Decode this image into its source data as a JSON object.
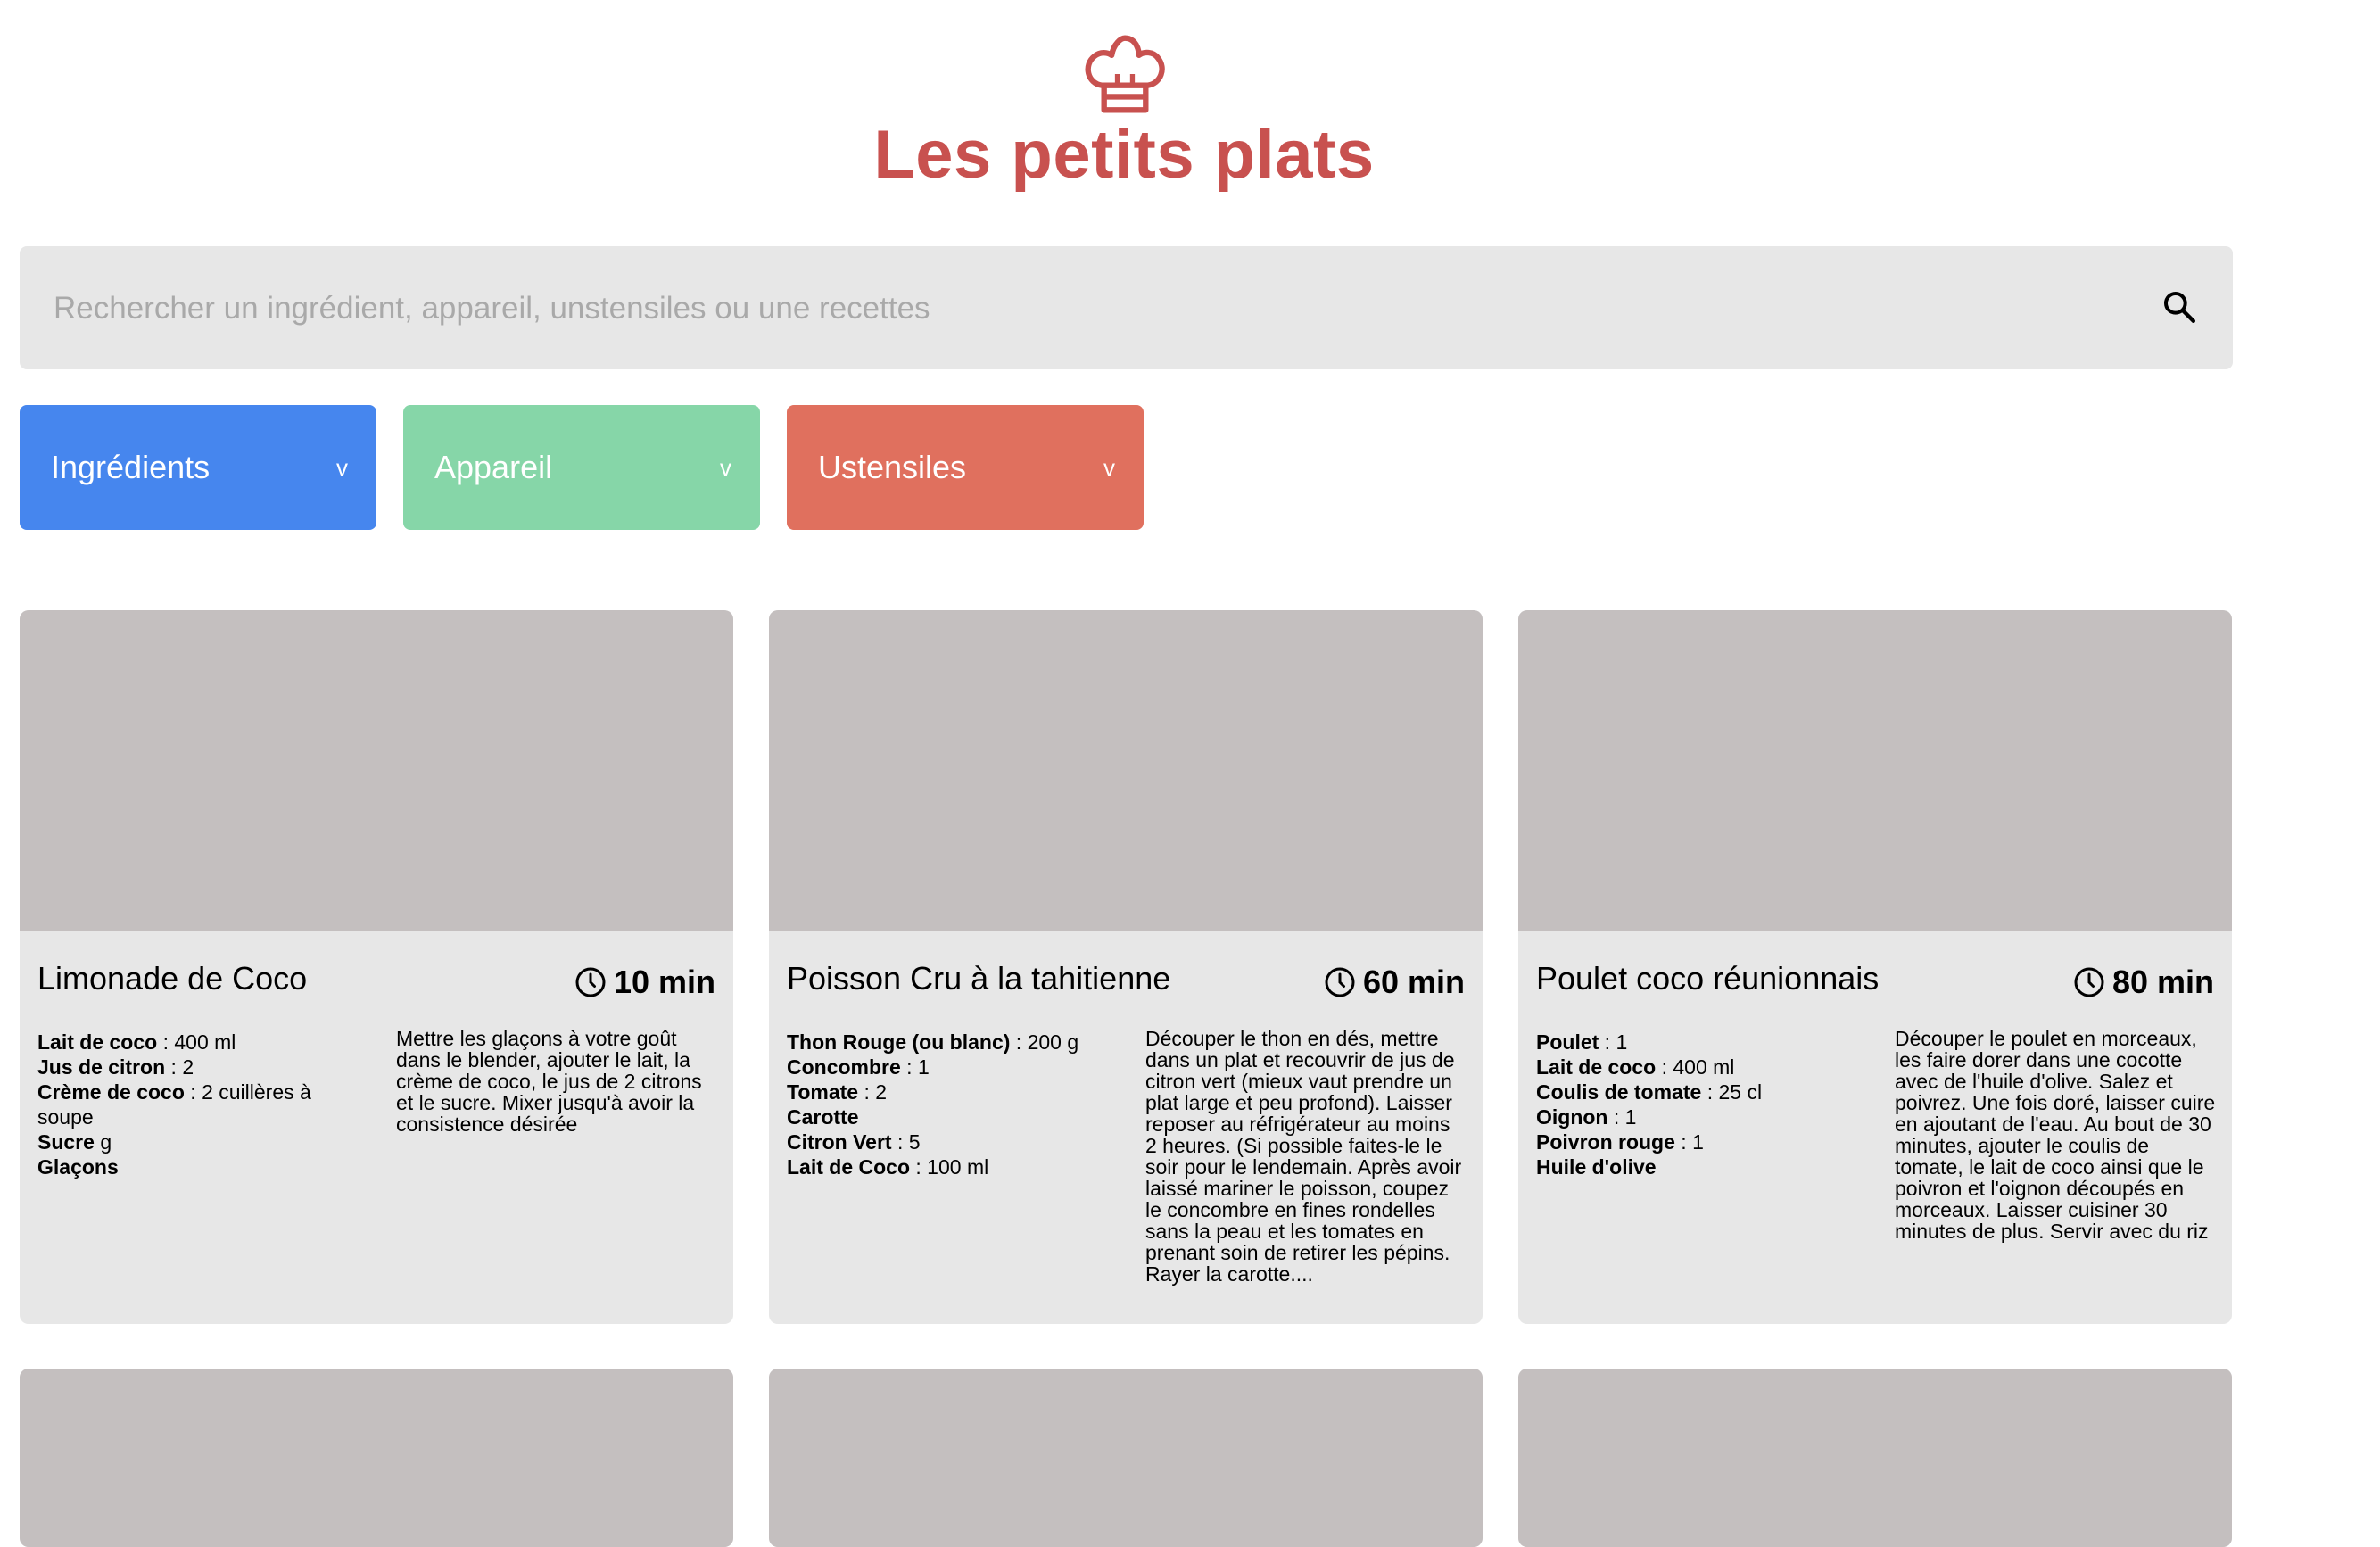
{
  "header": {
    "logo_icon": "chef-hat-icon",
    "brand": "Les petits plats",
    "brand_color": "#c8514f"
  },
  "search": {
    "placeholder": "Rechercher un ingrédient, appareil, unstensiles ou une recettes",
    "value": "",
    "icon": "search-icon"
  },
  "filters": [
    {
      "label": "Ingrédients",
      "color": "#4686ee",
      "icon": "chevron-down-icon",
      "chevron": "v"
    },
    {
      "label": "Appareil",
      "color": "#86d6a8",
      "icon": "chevron-down-icon",
      "chevron": "v"
    },
    {
      "label": "Ustensiles",
      "color": "#e0705e",
      "icon": "chevron-down-icon",
      "chevron": "v"
    }
  ],
  "recipes": [
    {
      "title": "Limonade de Coco",
      "time": "10 min",
      "ingredients": [
        {
          "name": "Lait de coco",
          "qty": " : 400 ml"
        },
        {
          "name": "Jus de citron",
          "qty": " : 2"
        },
        {
          "name": "Crème de coco",
          "qty": " : 2 cuillères à soupe"
        },
        {
          "name": "Sucre",
          "qty": " g"
        },
        {
          "name": "Glaçons",
          "qty": ""
        }
      ],
      "description": "Mettre les glaçons à votre goût dans le blender, ajouter le lait, la crème de coco, le jus de 2 citrons et le sucre. Mixer jusqu'à avoir la consistence désirée"
    },
    {
      "title": "Poisson Cru à la tahitienne",
      "time": "60 min",
      "ingredients": [
        {
          "name": "Thon Rouge (ou blanc)",
          "qty": " : 200 g"
        },
        {
          "name": "Concombre",
          "qty": " : 1"
        },
        {
          "name": "Tomate",
          "qty": " : 2"
        },
        {
          "name": "Carotte",
          "qty": ""
        },
        {
          "name": "Citron Vert",
          "qty": " : 5"
        },
        {
          "name": "Lait de Coco",
          "qty": " : 100 ml"
        }
      ],
      "description": "Découper le thon en dés, mettre dans un plat et recouvrir de jus de citron vert (mieux vaut prendre un plat large et peu profond). Laisser reposer au réfrigérateur au moins 2 heures. (Si possible faites-le le soir pour le lendemain. Après avoir laissé mariner le poisson, coupez le concombre en fines rondelles sans la peau et les tomates en prenant soin de retirer les pépins. Rayer la carotte...."
    },
    {
      "title": "Poulet coco réunionnais",
      "time": "80 min",
      "ingredients": [
        {
          "name": "Poulet",
          "qty": " : 1"
        },
        {
          "name": "Lait de coco",
          "qty": " : 400 ml"
        },
        {
          "name": "Coulis de tomate",
          "qty": " : 25 cl"
        },
        {
          "name": "Oignon",
          "qty": " : 1"
        },
        {
          "name": "Poivron rouge",
          "qty": " : 1"
        },
        {
          "name": "Huile d'olive",
          "qty": ""
        }
      ],
      "description": "Découper le poulet en morceaux, les faire dorer dans une cocotte avec de l'huile d'olive. Salez et poivrez. Une fois doré, laisser cuire en ajoutant de l'eau. Au bout de 30 minutes, ajouter le coulis de tomate, le lait de coco ainsi que le poivron et l'oignon découpés en morceaux. Laisser cuisiner 30 minutes de plus. Servir avec du riz"
    }
  ],
  "image_placeholder_color": "#c4bfbf",
  "time_icon": "clock-icon"
}
